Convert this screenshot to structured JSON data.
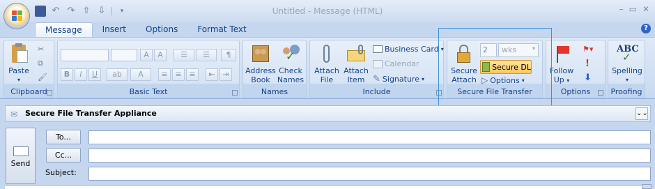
{
  "window": {
    "title": "Untitled - Message (HTML)"
  },
  "tabs": [
    {
      "label": "Message",
      "active": true
    },
    {
      "label": "Insert"
    },
    {
      "label": "Options"
    },
    {
      "label": "Format Text"
    }
  ],
  "ribbon": {
    "clipboard": {
      "label": "Clipboard",
      "paste": "Paste"
    },
    "basic_text": {
      "label": "Basic Text"
    },
    "names": {
      "label": "Names",
      "address_book": [
        "Address",
        "Book"
      ],
      "check_names": [
        "Check",
        "Names"
      ]
    },
    "include": {
      "label": "Include",
      "attach_file": [
        "Attach",
        "File"
      ],
      "attach_item": [
        "Attach",
        "Item"
      ],
      "business_card": "Business Card",
      "calendar": "Calendar",
      "signature": "Signature"
    },
    "secure_file_transfer": {
      "label": "Secure File Transfer",
      "secure_attach": [
        "Secure",
        "Attach"
      ],
      "expiry_value": "2",
      "expiry_unit": "wks",
      "secure_dl": "Secure DL",
      "options": "Options"
    },
    "options": {
      "label": "Options",
      "follow_up": [
        "Follow",
        "Up"
      ]
    },
    "proofing": {
      "label": "Proofing",
      "spelling": "Spelling",
      "abc": "ABC"
    }
  },
  "infobar": {
    "text": "Secure File Transfer Appliance"
  },
  "header": {
    "send": "Send",
    "to": "To...",
    "cc": "Cc...",
    "subject": "Subject:",
    "to_value": "",
    "cc_value": "",
    "subject_value": ""
  }
}
